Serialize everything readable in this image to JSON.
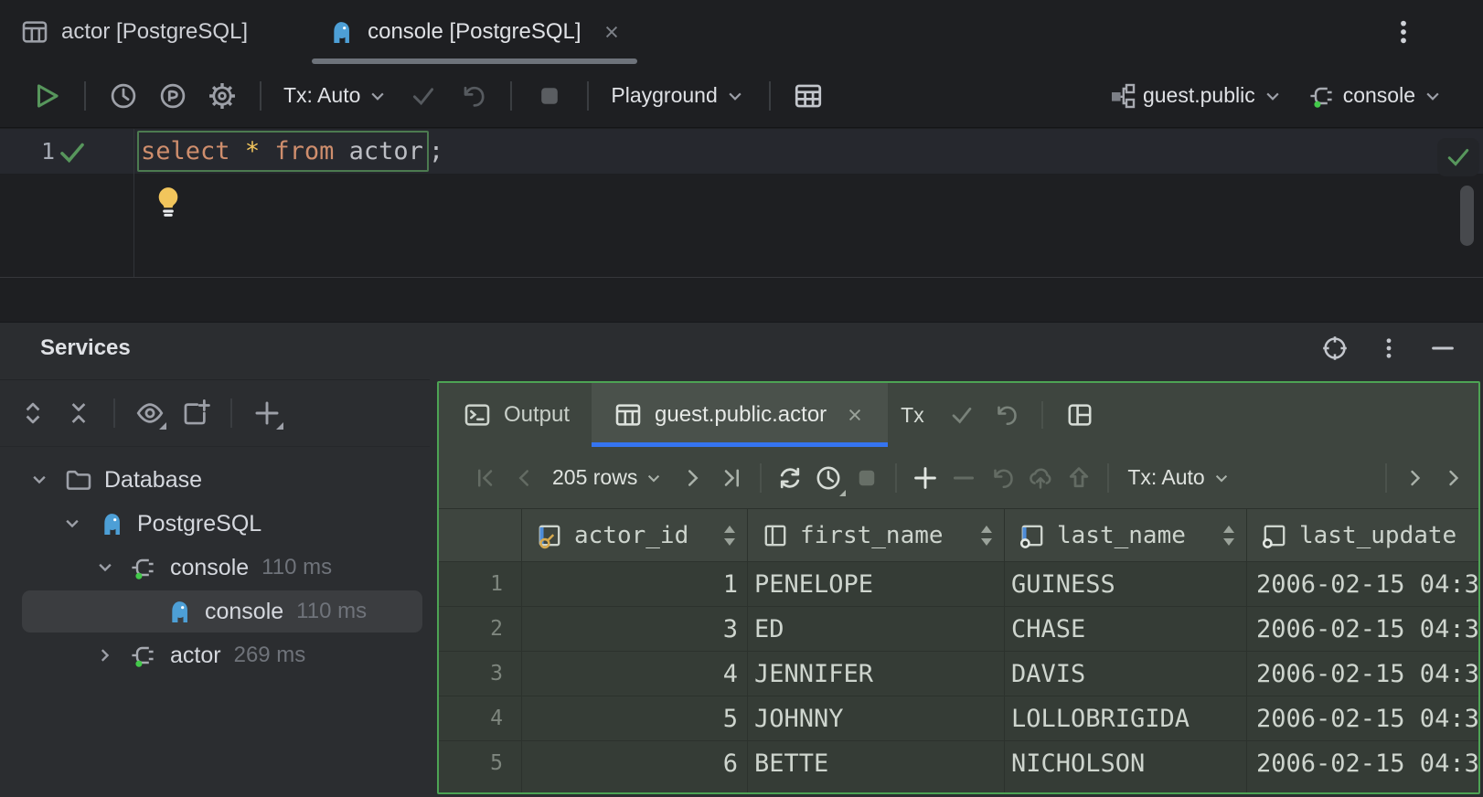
{
  "window": {
    "tabs": [
      {
        "label": "actor [PostgreSQL]"
      },
      {
        "label": "console [PostgreSQL]"
      }
    ]
  },
  "toolbar": {
    "tx_label": "Tx: Auto",
    "playground_label": "Playground",
    "schema_selector": "guest.public",
    "session_selector": "console"
  },
  "editor": {
    "line_number": "1",
    "code": {
      "kw1": "select",
      "star": "*",
      "kw2": "from",
      "ident": " actor",
      "semi": ";"
    }
  },
  "services": {
    "title": "Services",
    "tree": [
      {
        "label": "Database",
        "timing": ""
      },
      {
        "label": "PostgreSQL",
        "timing": ""
      },
      {
        "label": "console",
        "timing": "110 ms"
      },
      {
        "label": "console",
        "timing": "110 ms"
      },
      {
        "label": "actor",
        "timing": "269 ms"
      }
    ]
  },
  "results": {
    "tabs": {
      "output": "Output",
      "table": "guest.public.actor"
    },
    "tx_short": "Tx",
    "toolbar": {
      "rows_label": "205 rows",
      "tx_label": "Tx: Auto"
    },
    "grid": {
      "columns": [
        "actor_id",
        "first_name",
        "last_name",
        "last_update"
      ],
      "rows": [
        {
          "n": "1",
          "actor_id": "1",
          "first_name": "PENELOPE",
          "last_name": "GUINESS",
          "last_update": "2006-02-15 04:3"
        },
        {
          "n": "2",
          "actor_id": "3",
          "first_name": "ED",
          "last_name": "CHASE",
          "last_update": "2006-02-15 04:3"
        },
        {
          "n": "3",
          "actor_id": "4",
          "first_name": "JENNIFER",
          "last_name": "DAVIS",
          "last_update": "2006-02-15 04:3"
        },
        {
          "n": "4",
          "actor_id": "5",
          "first_name": "JOHNNY",
          "last_name": "LOLLOBRIGIDA",
          "last_update": "2006-02-15 04:3"
        },
        {
          "n": "5",
          "actor_id": "6",
          "first_name": "BETTE",
          "last_name": "NICHOLSON",
          "last_update": "2006-02-15 04:3"
        }
      ]
    }
  },
  "colors": {
    "accent_green": "#4da354",
    "accent_blue": "#3574f0",
    "postgres_blue": "#4d9fd6",
    "keyword_orange": "#cf8e6d"
  }
}
